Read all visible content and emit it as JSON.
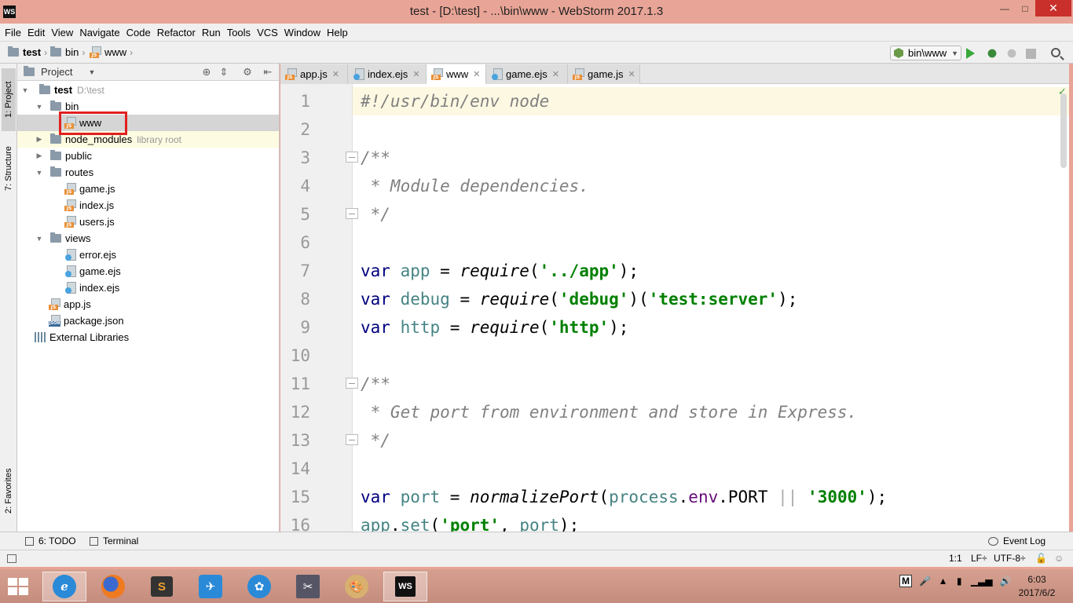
{
  "window": {
    "title": "test - [D:\\test] - ...\\bin\\www - WebStorm 2017.1.3",
    "app_icon": "WS",
    "close_glyph": "✕",
    "min_glyph": "—",
    "max_glyph": "□"
  },
  "menu": [
    "File",
    "Edit",
    "View",
    "Navigate",
    "Code",
    "Refactor",
    "Run",
    "Tools",
    "VCS",
    "Window",
    "Help"
  ],
  "breadcrumb": [
    "test",
    "bin",
    "www"
  ],
  "run_config": "bin\\www",
  "left_tool_tabs": {
    "project": "1: Project",
    "structure": "7: Structure",
    "favorites": "2: Favorites"
  },
  "project": {
    "header": "Project",
    "tree": {
      "root": {
        "name": "test",
        "path": "D:\\test"
      },
      "bin": "bin",
      "www": "www",
      "node_modules": "node_modules",
      "node_modules_hint": "library root",
      "public": "public",
      "routes": "routes",
      "routes_files": [
        "game.js",
        "index.js",
        "users.js"
      ],
      "views": "views",
      "views_files": [
        "error.ejs",
        "game.ejs",
        "index.ejs"
      ],
      "app": "app.js",
      "package": "package.json",
      "external": "External Libraries"
    }
  },
  "editor_tabs": [
    "app.js",
    "index.ejs",
    "www",
    "game.ejs",
    "game.js"
  ],
  "active_tab": "www",
  "editor": {
    "line_numbers": [
      "1",
      "2",
      "3",
      "4",
      "5",
      "6",
      "7",
      "8",
      "9",
      "10",
      "11",
      "12",
      "13",
      "14",
      "15",
      "16"
    ],
    "code": {
      "l1": "#!/usr/bin/env node",
      "l3": "/**",
      "l4": " * Module dependencies.",
      "l5": " */",
      "l7": {
        "kw": "var",
        "name": " app",
        "eq": " = ",
        "fn": "require",
        "open": "(",
        "str": "'../app'",
        "close": ");"
      },
      "l8": {
        "kw": "var",
        "name": " debug",
        "eq": " = ",
        "fn": "require",
        "open": "(",
        "str": "'debug'",
        "mid": ")(",
        "str2": "'test:server'",
        "close": ");"
      },
      "l9": {
        "kw": "var",
        "name": " http",
        "eq": " = ",
        "fn": "require",
        "open": "(",
        "str": "'http'",
        "close": ");"
      },
      "l11": "/**",
      "l12": " * Get port from environment and store in Express.",
      "l13": " */",
      "l15": {
        "kw": "var",
        "name": " port",
        "eq": " = ",
        "fn": "normalizePort",
        "open": "(",
        "obj": "process",
        "dot1": ".",
        "prop": "env",
        "dot2": ".",
        "const": "PORT",
        "op": " || ",
        "str": "'3000'",
        "close": ");"
      },
      "l16": {
        "obj": "app",
        "dot": ".",
        "method": "set",
        "open": "(",
        "str": "'port'",
        "comma": ", ",
        "arg": "port",
        "close": ");"
      }
    }
  },
  "bottom_tools": {
    "todo": "6: TODO",
    "terminal": "Terminal",
    "event_log": "Event Log"
  },
  "status": {
    "position": "1:1",
    "line_sep": "LF÷",
    "encoding": "UTF-8÷"
  },
  "taskbar": {
    "tray_m": "M",
    "time": "6:03",
    "date": "2017/6/2"
  },
  "colors": {
    "titlebar": "#e8a496",
    "keyword": "#000080",
    "string": "#008000",
    "comment": "#808080",
    "current_line": "#fdf8e2"
  }
}
